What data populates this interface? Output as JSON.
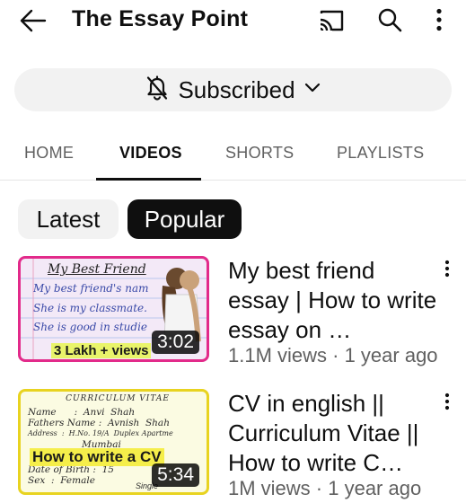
{
  "header": {
    "title": "The Essay Point",
    "icons": [
      "back-arrow-icon",
      "cast-icon",
      "search-icon",
      "more-vert-icon"
    ]
  },
  "subscribe": {
    "label": "Subscribed",
    "icons": [
      "bell-off-icon",
      "chevron-down-icon"
    ]
  },
  "tabs": [
    {
      "label": "HOME"
    },
    {
      "label": "VIDEOS"
    },
    {
      "label": "SHORTS"
    },
    {
      "label": "PLAYLISTS"
    }
  ],
  "chips": [
    {
      "label": "Latest"
    },
    {
      "label": "Popular"
    }
  ],
  "videos": [
    {
      "title": "My best friend essay | How to write essay on …",
      "meta": "1.1M views · 1 year ago",
      "duration": "3:02",
      "thumb": {
        "lines": [
          "My Best Friend",
          "My best friend's nam",
          "She is my classmate.",
          "She is good in studie"
        ],
        "caption": "3 Lakh + views",
        "border_color": "#e22a8a"
      }
    },
    {
      "title": "CV in english  || Curriculum Vitae || How to write C…",
      "meta": "1M views · 1 year ago",
      "duration": "5:34",
      "thumb": {
        "lines": [
          "CURRICULUM VITAE",
          "Name      :  Anvi  Shah",
          "Fathers Name :  Avnish  Shah",
          "Address  :  H.No. 19/A  Duplex Apartme",
          "Mumbai",
          "Date of Birth :  15",
          "Sex  :  Female",
          "Single"
        ],
        "caption": "How to write a CV",
        "border_color": "#e8d320"
      }
    }
  ]
}
